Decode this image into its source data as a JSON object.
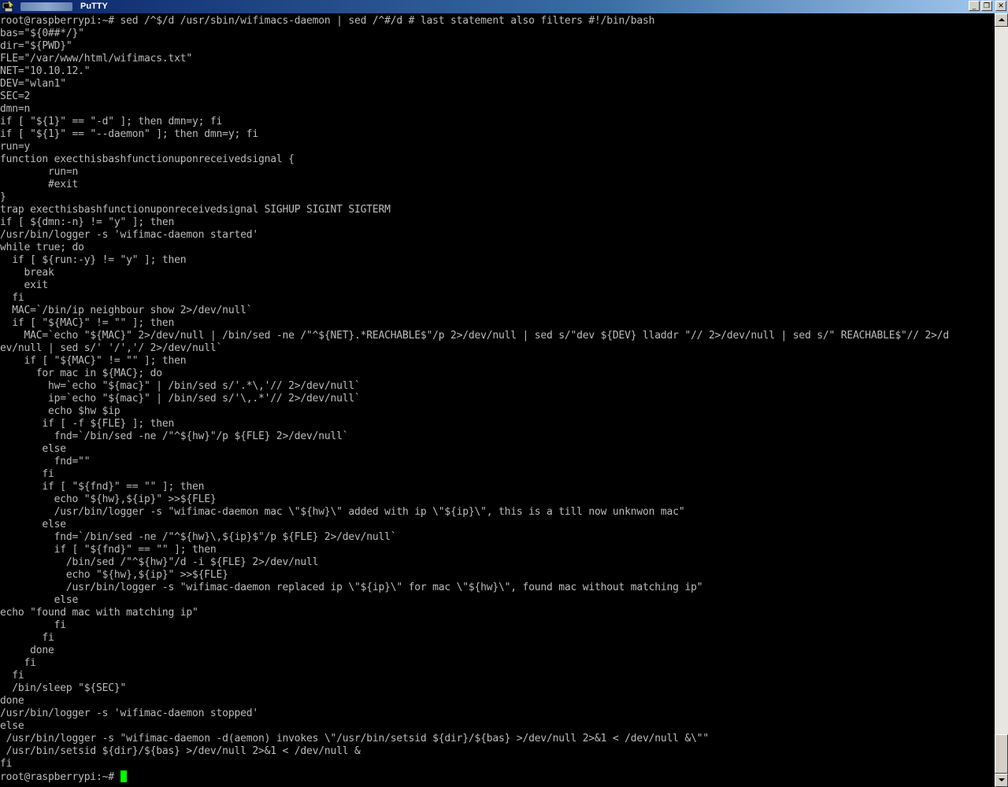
{
  "window": {
    "title": "PuTTY",
    "icon": "putty-icon",
    "controls": {
      "minimize": "_",
      "maximize": "❐",
      "close": "✕"
    }
  },
  "colors": {
    "background": "#000000",
    "text": "#bbbbbb",
    "cursor": "#00ff00"
  },
  "terminal": {
    "lines": [
      "root@raspberrypi:~# sed /^$/d /usr/sbin/wifimacs-daemon | sed /^#/d # last statement also filters #!/bin/bash",
      "bas=\"${0##*/}\"",
      "dir=\"${PWD}\"",
      "FLE=\"/var/www/html/wifimacs.txt\"",
      "NET=\"10.10.12.\"",
      "DEV=\"wlan1\"",
      "SEC=2",
      "dmn=n",
      "if [ \"${1}\" == \"-d\" ]; then dmn=y; fi",
      "if [ \"${1}\" == \"--daemon\" ]; then dmn=y; fi",
      "run=y",
      "function execthisbashfunctionuponreceivedsignal {",
      "        run=n",
      "        #exit",
      "}",
      "trap execthisbashfunctionuponreceivedsignal SIGHUP SIGINT SIGTERM",
      "if [ ${dmn:-n} != \"y\" ]; then",
      "/usr/bin/logger -s 'wifimac-daemon started'",
      "while true; do",
      "  if [ ${run:-y} != \"y\" ]; then",
      "    break",
      "    exit",
      "  fi",
      "  MAC=`/bin/ip neighbour show 2>/dev/null`",
      "  if [ \"${MAC}\" != \"\" ]; then",
      "    MAC=`echo \"${MAC}\" 2>/dev/null | /bin/sed -ne /\"^${NET}.*REACHABLE$\"/p 2>/dev/null | sed s/\"dev ${DEV} lladdr \"// 2>/dev/null | sed s/\" REACHABLE$\"// 2>/d",
      "ev/null | sed s/' '/','/ 2>/dev/null`",
      "    if [ \"${MAC}\" != \"\" ]; then",
      "      for mac in ${MAC}; do",
      "        hw=`echo \"${mac}\" | /bin/sed s/'.*\\,'// 2>/dev/null`",
      "        ip=`echo \"${mac}\" | /bin/sed s/'\\,.*'// 2>/dev/null`",
      "        echo $hw $ip",
      "       if [ -f ${FLE} ]; then",
      "         fnd=`/bin/sed -ne /\"^${hw}\"/p ${FLE} 2>/dev/null`",
      "       else",
      "         fnd=\"\"",
      "       fi",
      "       if [ \"${fnd}\" == \"\" ]; then",
      "         echo \"${hw},${ip}\" >>${FLE}",
      "         /usr/bin/logger -s \"wifimac-daemon mac \\\"${hw}\\\" added with ip \\\"${ip}\\\", this is a till now unknwon mac\"",
      "       else",
      "         fnd=`/bin/sed -ne /\"^${hw}\\,${ip}$\"/p ${FLE} 2>/dev/null`",
      "         if [ \"${fnd}\" == \"\" ]; then",
      "           /bin/sed /\"^${hw}\"/d -i ${FLE} 2>/dev/null",
      "           echo \"${hw},${ip}\" >>${FLE}",
      "           /usr/bin/logger -s \"wifimac-daemon replaced ip \\\"${ip}\\\" for mac \\\"${hw}\\\", found mac without matching ip\"",
      "         else",
      "echo \"found mac with matching ip\"",
      "         fi",
      "       fi",
      "     done",
      "    fi",
      "  fi",
      "  /bin/sleep \"${SEC}\"",
      "done",
      "/usr/bin/logger -s 'wifimac-daemon stopped'",
      "else",
      " /usr/bin/logger -s \"wifimac-daemon -d(aemon) invokes \\\"/usr/bin/setsid ${dir}/${bas} >/dev/null 2>&1 < /dev/null &\\\"\"",
      " /usr/bin/setsid ${dir}/${bas} >/dev/null 2>&1 < /dev/null &",
      "fi"
    ],
    "prompt": "root@raspberrypi:~# "
  }
}
